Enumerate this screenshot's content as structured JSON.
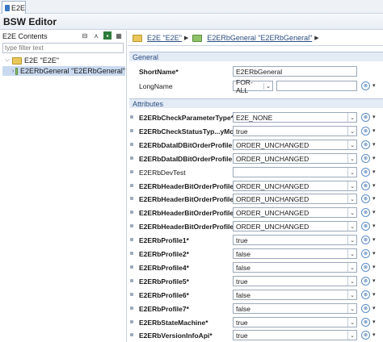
{
  "window": {
    "tab_label": "E2E",
    "editor_title": "BSW Editor"
  },
  "left": {
    "header": "E2E Contents",
    "filter_placeholder": "type filter text",
    "tree": [
      {
        "label": "E2E \"E2E\"",
        "expanded": "⌵"
      },
      {
        "label": "E2ERbGeneral \"E2ERbGeneral\"",
        "expanded": "›"
      }
    ]
  },
  "breadcrumb": {
    "item1": "E2E \"E2E\"",
    "item2": "E2ERbGeneral \"E2ERbGeneral\""
  },
  "general": {
    "title": "General",
    "short_name_label": "ShortName*",
    "short_name_value": "E2ERbGeneral",
    "long_name_label": "LongName",
    "long_name_lang": "FOR-ALL"
  },
  "attributes": {
    "title": "Attributes",
    "rows": [
      {
        "label": "E2ERbCheckParameterType*",
        "value": "E2E_NONE"
      },
      {
        "label": "E2ERbCheckStatusTyp...yMo",
        "value": "true"
      },
      {
        "label": "E2ERbDataIDBitOrderProfile",
        "value": "ORDER_UNCHANGED"
      },
      {
        "label": "E2ERbDataIDBitOrderProfile",
        "value": "ORDER_UNCHANGED"
      },
      {
        "label": "E2ERbDevTest",
        "value": ""
      },
      {
        "label": "E2ERbHeaderBitOrderProfile",
        "value": "ORDER_UNCHANGED"
      },
      {
        "label": "E2ERbHeaderBitOrderProfile",
        "value": "ORDER_UNCHANGED"
      },
      {
        "label": "E2ERbHeaderBitOrderProfile",
        "value": "ORDER_UNCHANGED"
      },
      {
        "label": "E2ERbHeaderBitOrderProfile",
        "value": "ORDER_UNCHANGED"
      },
      {
        "label": "E2ERbProfile1*",
        "value": "true"
      },
      {
        "label": "E2ERbProfile2*",
        "value": "false"
      },
      {
        "label": "E2ERbProfile4*",
        "value": "false"
      },
      {
        "label": "E2ERbProfile5*",
        "value": "true"
      },
      {
        "label": "E2ERbProfile6*",
        "value": "false"
      },
      {
        "label": "E2ERbProfile7*",
        "value": "false"
      },
      {
        "label": "E2ERbStateMachine*",
        "value": "true"
      },
      {
        "label": "E2ERbVersionInfoApi*",
        "value": "true"
      }
    ]
  },
  "icons": {
    "reset": "⊗",
    "menu_arrow": "▾",
    "dropdown": "⌄",
    "crumb_sep": "▶"
  }
}
